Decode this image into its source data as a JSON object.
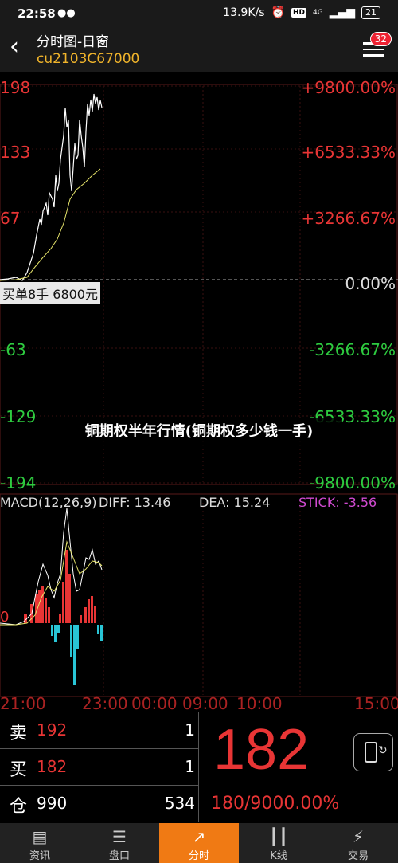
{
  "status_bar": {
    "time": "22:58",
    "speed": "13.9K/s",
    "network": "4G",
    "battery": "21"
  },
  "header": {
    "title": "分时图-日窗",
    "contract": "cu2103C67000",
    "badge": "32"
  },
  "price_axis": {
    "left": [
      "198",
      "133",
      "67",
      "-63",
      "-129",
      "-194"
    ],
    "right": [
      "+9800.00%",
      "+6533.33%",
      "+3266.67%",
      "0.00%",
      "-3266.67%",
      "-6533.33%",
      "-9800.00%"
    ]
  },
  "buyer_label": "买单8手  6800元",
  "overlay_title": "铜期权半年行情(铜期权多少钱一手)",
  "macd": {
    "label": "MACD(12,26,9)",
    "diff": "DIFF: 13.46",
    "dea": "DEA: 15.24",
    "stick": "STICK: -3.56",
    "zero": "0"
  },
  "time_axis": [
    "21:00",
    "23:00",
    "00:00",
    "09:00",
    "10:00",
    "15:00"
  ],
  "order_book": {
    "sell_label": "卖",
    "sell_price": "192",
    "sell_vol": "1",
    "buy_label": "买",
    "buy_price": "182",
    "buy_vol": "1",
    "pos_label": "仓",
    "pos_value": "990",
    "pos_change": "534"
  },
  "last_price": "182",
  "last_change": "180/9000.00%",
  "nav": [
    {
      "label": "资讯",
      "icon": "news-icon"
    },
    {
      "label": "盘口",
      "icon": "list-icon"
    },
    {
      "label": "分时",
      "icon": "trend-icon"
    },
    {
      "label": "K线",
      "icon": "candlestick-icon"
    },
    {
      "label": "交易",
      "icon": "lightning-icon"
    }
  ],
  "colors": {
    "up": "#e83535",
    "down": "#2ecc40",
    "accent": "#f07a14",
    "contract": "#f0b42b",
    "macd_neg": "#29c5d6",
    "stick": "#d04ad0"
  }
}
